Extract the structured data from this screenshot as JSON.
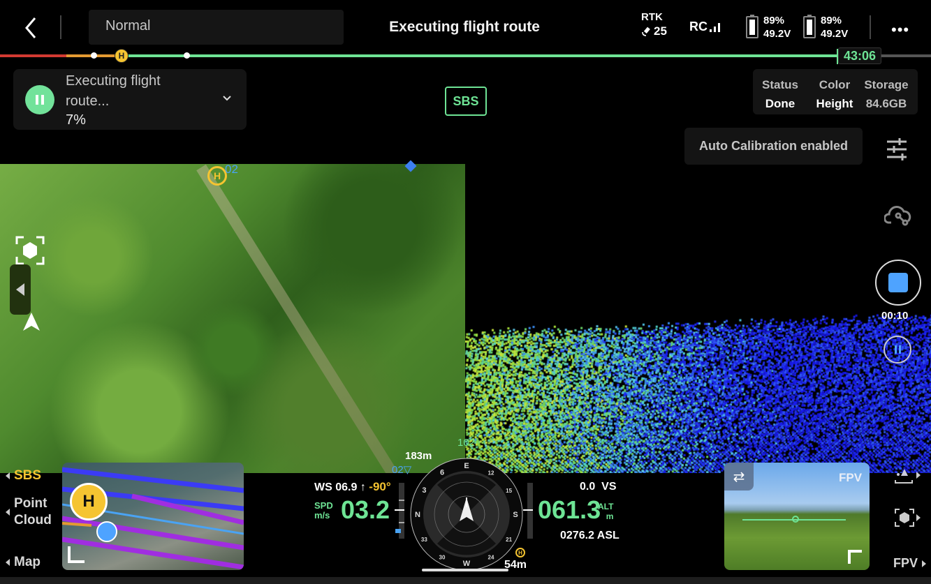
{
  "top_bar": {
    "mode": "Normal",
    "title": "Executing flight route",
    "rtk": {
      "label": "RTK",
      "satellites": "25"
    },
    "rc": {
      "label": "RC"
    },
    "batteries": [
      {
        "percent": "89%",
        "voltage": "49.2V"
      },
      {
        "percent": "89%",
        "voltage": "49.2V"
      }
    ],
    "more_label": "•••",
    "time_remaining": "43:06",
    "home_marker": "H"
  },
  "colors": {
    "accent_green": "#6ee495",
    "home_yellow": "#f5c431",
    "waypoint_blue": "#4aa3f3",
    "record_blue": "#4ea3ff",
    "progress_red": "#d23a32",
    "progress_orange": "#e49a32"
  },
  "task": {
    "title": "Executing flight route...",
    "progress_percent": "7%",
    "state_icon": "pause-icon"
  },
  "sbs_badge": "SBS",
  "status_panel": {
    "columns": [
      {
        "label": "Status",
        "value": "Done"
      },
      {
        "label": "Color",
        "value": "Height"
      },
      {
        "label": "Storage",
        "value": "84.6GB"
      }
    ]
  },
  "auto_calibration": "Auto Calibration enabled",
  "view_markers": {
    "home": "H",
    "waypoint_top": "02",
    "waypoint_bottom": "02▽",
    "heading": "102",
    "distance_top": "183m"
  },
  "recording": {
    "elapsed": "00:10"
  },
  "side_labels": {
    "sbs": "SBS",
    "point_cloud_line1": "Point",
    "point_cloud_line2": "Cloud",
    "map": "Map",
    "fpv": "FPV"
  },
  "minimap": {
    "home": "H"
  },
  "telemetry": {
    "ws_label": "WS",
    "wind_speed": "06.9",
    "wind_arrow": "↑",
    "gimbal_pitch": "-90°",
    "spd_label": "SPD",
    "spd_unit": "m/s",
    "speed": "03.2",
    "vs_value": "0.0",
    "vs_label": "VS",
    "altitude": "061.3",
    "alt_label": "ALT",
    "alt_unit": "m",
    "asl": "0276.2 ASL",
    "home_distance": "54m"
  },
  "compass": {
    "labels": [
      "N",
      "3",
      "6",
      "E",
      "12",
      "15",
      "S",
      "21",
      "24",
      "W",
      "30",
      "33"
    ]
  },
  "fpv": {
    "label": "FPV",
    "swap_icon": "⇄"
  }
}
